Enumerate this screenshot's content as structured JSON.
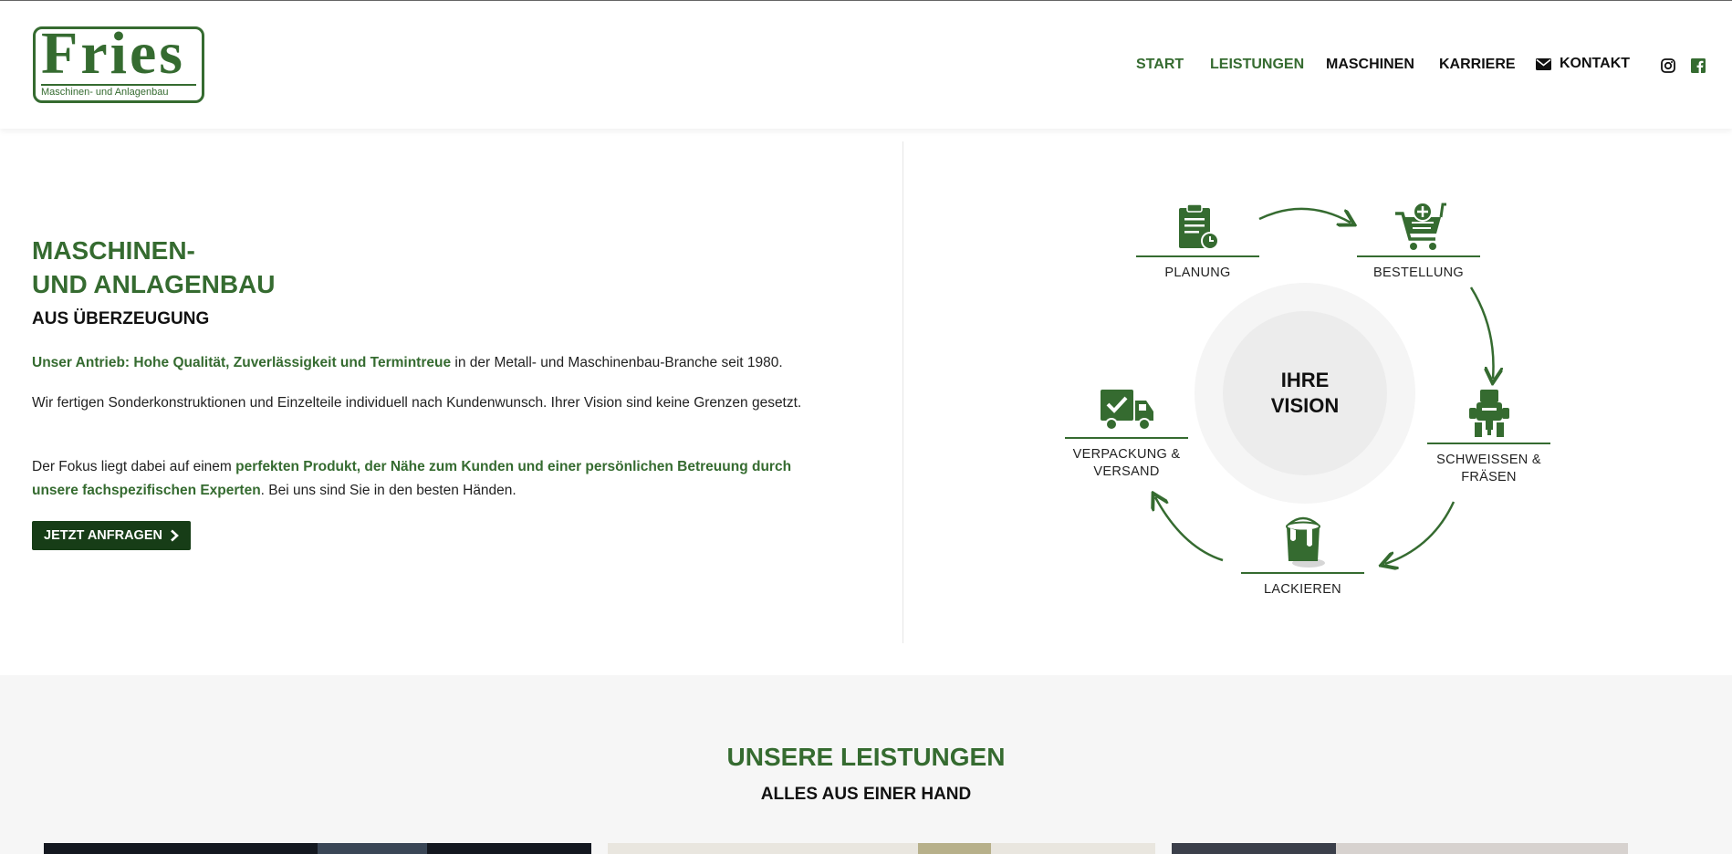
{
  "logo": {
    "word": "Fries",
    "subtitle": "Maschinen- und Anlagenbau"
  },
  "nav": {
    "items": [
      {
        "label": "START",
        "active": true
      },
      {
        "label": "LEISTUNGEN",
        "active": true
      },
      {
        "label": "MASCHINEN",
        "active": false
      },
      {
        "label": "KARRIERE",
        "active": false
      },
      {
        "label": "KONTAKT",
        "active": false,
        "icon": "envelope-icon"
      }
    ],
    "social": [
      "instagram-icon",
      "facebook-icon"
    ]
  },
  "hero": {
    "title_line1": "MASCHINEN-",
    "title_line2": "UND ANLAGENBAU",
    "subtitle": "AUS ÜBERZEUGUNG",
    "p1_highlight": "Unser Antrieb: Hohe Qualität, Zuverlässigkeit und Termintreue",
    "p1_rest": " in der Metall- und Maschinenbau-Branche seit 1980.",
    "p2": "Wir fertigen Sonderkonstruktionen und Einzelteile individuell nach Kundenwunsch. Ihrer Vision sind keine Grenzen gesetzt.",
    "p3_start": "Der Fokus liegt dabei auf einem ",
    "p3_highlight": "perfekten Produkt, der Nähe zum Kunden und einer persönlichen Betreuung durch unsere fachspezifischen Experten",
    "p3_end": ". Bei uns sind Sie in den besten Händen.",
    "cta_label": "JETZT ANFRAGEN"
  },
  "process": {
    "center_line1": "IHRE",
    "center_line2": "VISION",
    "steps": {
      "planung": "PLANUNG",
      "bestellung": "BESTELLUNG",
      "schweissen_1": "SCHWEISSEN &",
      "schweissen_2": "FRÄSEN",
      "lackieren": "LACKIEREN",
      "versand_1": "VERPACKUNG &",
      "versand_2": "VERSAND"
    }
  },
  "services": {
    "title": "UNSERE LEISTUNGEN",
    "subtitle": "ALLES AUS EINER HAND"
  },
  "colors": {
    "brand_green": "#356b30",
    "button_dark": "#173d17"
  }
}
